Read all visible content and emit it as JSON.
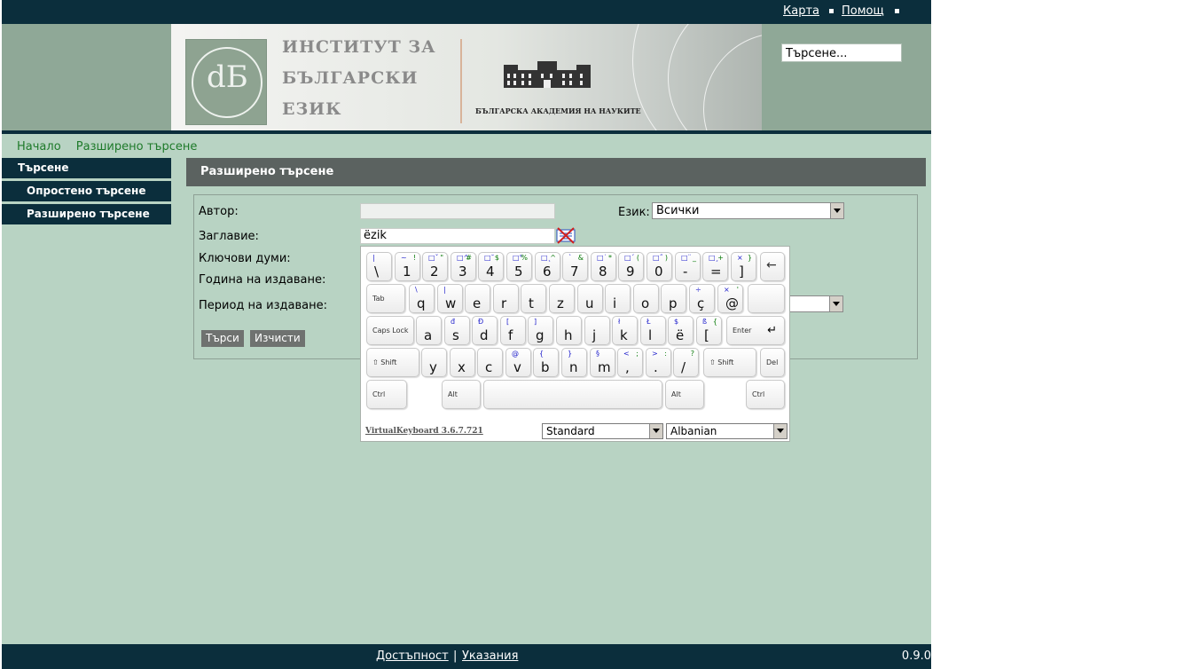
{
  "topbar": {
    "links": [
      "Карта",
      "Помощ"
    ]
  },
  "header": {
    "institute_lines": [
      "ИНСТИТУТ ЗА",
      "БЪЛГАРСКИ",
      "ЕЗИК"
    ],
    "academy": "БЪЛГАРСКА АКАДЕМИЯ НА НАУКИТЕ",
    "search_value": "Търсене..."
  },
  "breadcrumb": [
    "Начало",
    "Разширено търсене"
  ],
  "sidebar": {
    "section": "Търсене",
    "items": [
      "Опростено търсене",
      "Разширено търсене"
    ]
  },
  "page_title": "Разширено търсене",
  "form": {
    "author_label": "Автор:",
    "author_value": "",
    "language_label": "Език:",
    "language_value": "Всички",
    "title_label": "Заглавие:",
    "title_value": "ëzik",
    "keywords_label": "Ключови думи:",
    "year_label": "Година на издаване:",
    "period_label": "Период на издаване:",
    "search_button": "Търси",
    "clear_button": "Изчисти"
  },
  "virtual_keyboard": {
    "link": "VirtualKeyboard 3.6.7.721",
    "layout_value": "Standard",
    "language_value": "Albanian",
    "keys": {
      "backspace": "←",
      "tab": "Tab",
      "caps": "Caps Lock",
      "enter": "Enter",
      "shift_left": "⇧ Shift",
      "shift_right": "⇧ Shift",
      "del": "Del",
      "ctrl_left": "Ctrl",
      "alt_left": "Alt",
      "alt_right": "Alt",
      "ctrl_right": "Ctrl"
    },
    "rows": [
      [
        {
          "m": "\\",
          "s": "|",
          "a": ""
        },
        {
          "m": "1",
          "s": "~",
          "a": "!"
        },
        {
          "m": "2",
          "s": "□ˇ",
          "a": "\""
        },
        {
          "m": "3",
          "s": "□^",
          "a": "#"
        },
        {
          "m": "4",
          "s": "□˘",
          "a": "$"
        },
        {
          "m": "5",
          "s": "□°",
          "a": "%"
        },
        {
          "m": "6",
          "s": "□˛",
          "a": "^"
        },
        {
          "m": "7",
          "s": "`",
          "a": "&"
        },
        {
          "m": "8",
          "s": "□˙",
          "a": "*"
        },
        {
          "m": "9",
          "s": "□´",
          "a": "("
        },
        {
          "m": "0",
          "s": "□˝",
          "a": ")"
        },
        {
          "m": "-",
          "s": "□¨",
          "a": "_"
        },
        {
          "m": "=",
          "s": "□¸",
          "a": "+"
        },
        {
          "m": "]",
          "s": "×",
          "a": "}"
        }
      ],
      [
        {
          "m": "q",
          "s": "\\",
          "a": ""
        },
        {
          "m": "w",
          "s": "|",
          "a": ""
        },
        {
          "m": "e",
          "s": "",
          "a": ""
        },
        {
          "m": "r",
          "s": "",
          "a": ""
        },
        {
          "m": "t",
          "s": "",
          "a": ""
        },
        {
          "m": "z",
          "s": "",
          "a": ""
        },
        {
          "m": "u",
          "s": "",
          "a": ""
        },
        {
          "m": "i",
          "s": "",
          "a": ""
        },
        {
          "m": "o",
          "s": "",
          "a": ""
        },
        {
          "m": "p",
          "s": "",
          "a": ""
        },
        {
          "m": "ç",
          "s": "÷",
          "a": ""
        },
        {
          "m": "@",
          "s": "×",
          "a": "'"
        }
      ],
      [
        {
          "m": "a",
          "s": "",
          "a": ""
        },
        {
          "m": "s",
          "s": "đ",
          "a": ""
        },
        {
          "m": "d",
          "s": "Đ",
          "a": ""
        },
        {
          "m": "f",
          "s": "[",
          "a": ""
        },
        {
          "m": "g",
          "s": "]",
          "a": ""
        },
        {
          "m": "h",
          "s": "",
          "a": ""
        },
        {
          "m": "j",
          "s": "",
          "a": ""
        },
        {
          "m": "k",
          "s": "ł",
          "a": ""
        },
        {
          "m": "l",
          "s": "Ł",
          "a": ""
        },
        {
          "m": "ë",
          "s": "$",
          "a": ""
        },
        {
          "m": "[",
          "s": "ß",
          "a": "{"
        }
      ],
      [
        {
          "m": "y",
          "s": "",
          "a": ""
        },
        {
          "m": "x",
          "s": "",
          "a": ""
        },
        {
          "m": "c",
          "s": "",
          "a": ""
        },
        {
          "m": "v",
          "s": "@",
          "a": ""
        },
        {
          "m": "b",
          "s": "{",
          "a": ""
        },
        {
          "m": "n",
          "s": "}",
          "a": ""
        },
        {
          "m": "m",
          "s": "§",
          "a": ""
        },
        {
          "m": ",",
          "s": "<",
          "a": ";"
        },
        {
          "m": ".",
          "s": ">",
          "a": ":"
        },
        {
          "m": "/",
          "s": "",
          "a": "?"
        }
      ]
    ]
  },
  "footer": {
    "links": [
      "Достъпност",
      "Указания"
    ],
    "separator": "|",
    "version": "0.9.0"
  },
  "colors": {
    "dark_bar": "#0b2e3c",
    "page_bg": "#b8d3c3",
    "title_bar": "#5b6260",
    "breadcrumb": "#1e7a2a"
  }
}
